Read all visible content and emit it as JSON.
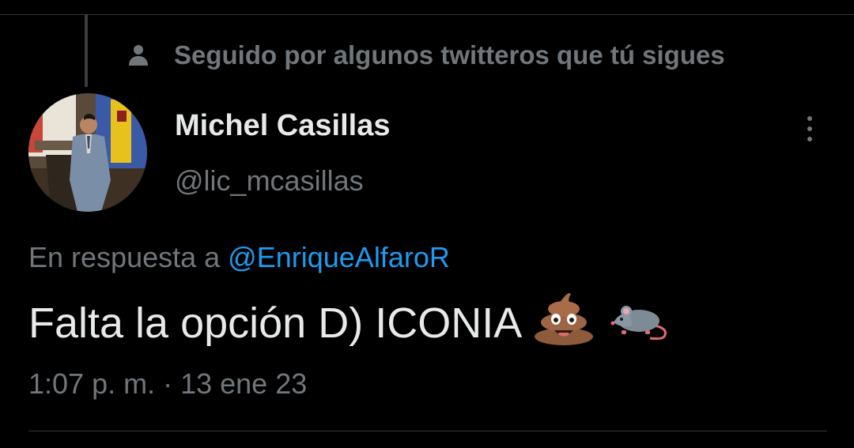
{
  "social_context": {
    "icon": "person-icon",
    "text": "Seguido por algunos twitteros que tú sigues"
  },
  "author": {
    "display_name": "Michel Casillas",
    "handle": "@lic_mcasillas",
    "avatar": "avatar-photo"
  },
  "more_menu": {
    "icon": "more-vertical-icon"
  },
  "reply": {
    "prefix": "En respuesta a",
    "mention": "@EnriqueAlfaroR"
  },
  "tweet": {
    "text": "Falta la opción D) ICONIA",
    "emojis": [
      "pile-of-poo-emoji",
      "rat-emoji"
    ]
  },
  "timestamp": "1:07 p. m. · 13 ene 23",
  "colors": {
    "background": "#000000",
    "primary_text": "#e7e9ea",
    "secondary_text": "#71767b",
    "accent": "#1d9bf0",
    "divider": "#2f3336"
  }
}
